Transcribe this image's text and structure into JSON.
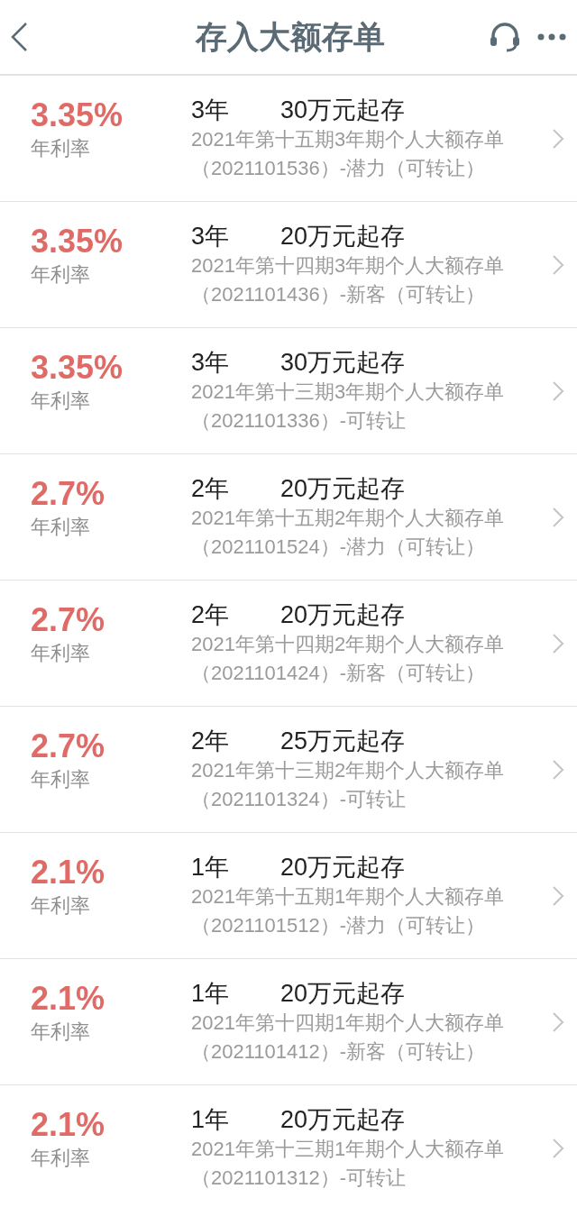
{
  "header": {
    "title": "存入大额存单"
  },
  "products": [
    {
      "rate": "3.35%",
      "rate_label": "年利率",
      "term": "3年",
      "minimum": "30万元起存",
      "name": "2021年第十五期3年期个人大额存单",
      "code": "（2021101536）-潜力（可转让）"
    },
    {
      "rate": "3.35%",
      "rate_label": "年利率",
      "term": "3年",
      "minimum": "20万元起存",
      "name": "2021年第十四期3年期个人大额存单",
      "code": "（2021101436）-新客（可转让）"
    },
    {
      "rate": "3.35%",
      "rate_label": "年利率",
      "term": "3年",
      "minimum": "30万元起存",
      "name": "2021年第十三期3年期个人大额存单",
      "code": "（2021101336）-可转让"
    },
    {
      "rate": "2.7%",
      "rate_label": "年利率",
      "term": "2年",
      "minimum": "20万元起存",
      "name": "2021年第十五期2年期个人大额存单",
      "code": "（2021101524）-潜力（可转让）"
    },
    {
      "rate": "2.7%",
      "rate_label": "年利率",
      "term": "2年",
      "minimum": "20万元起存",
      "name": "2021年第十四期2年期个人大额存单",
      "code": "（2021101424）-新客（可转让）"
    },
    {
      "rate": "2.7%",
      "rate_label": "年利率",
      "term": "2年",
      "minimum": "25万元起存",
      "name": "2021年第十三期2年期个人大额存单",
      "code": "（2021101324）-可转让"
    },
    {
      "rate": "2.1%",
      "rate_label": "年利率",
      "term": "1年",
      "minimum": "20万元起存",
      "name": "2021年第十五期1年期个人大额存单",
      "code": "（2021101512）-潜力（可转让）"
    },
    {
      "rate": "2.1%",
      "rate_label": "年利率",
      "term": "1年",
      "minimum": "20万元起存",
      "name": "2021年第十四期1年期个人大额存单",
      "code": "（2021101412）-新客（可转让）"
    },
    {
      "rate": "2.1%",
      "rate_label": "年利率",
      "term": "1年",
      "minimum": "20万元起存",
      "name": "2021年第十三期1年期个人大额存单",
      "code": "（2021101312）-可转让"
    }
  ]
}
